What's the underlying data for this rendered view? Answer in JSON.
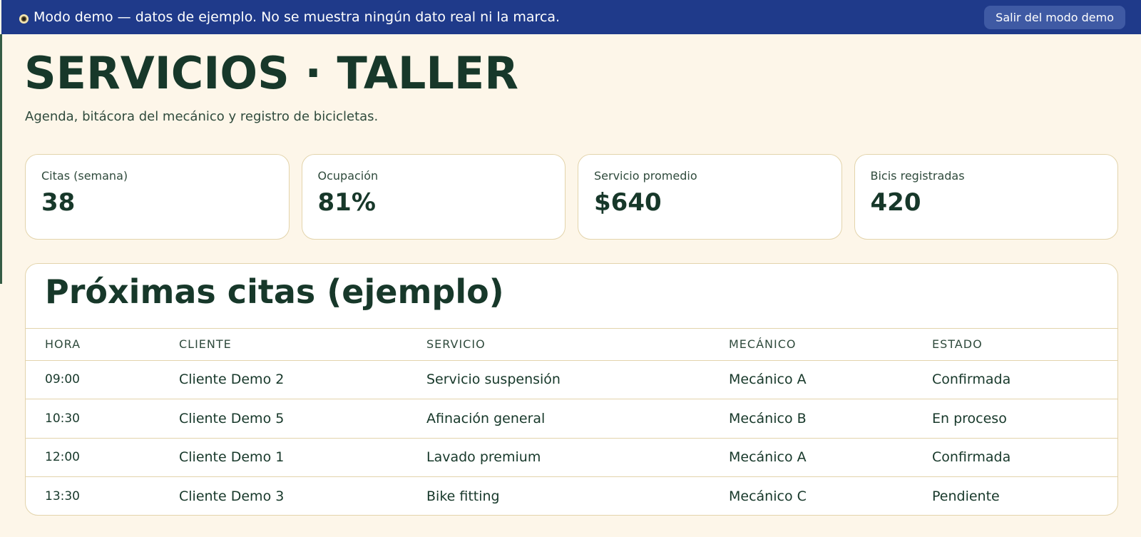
{
  "banner": {
    "message": "Modo demo — datos de ejemplo. No se muestra ningún dato real ni la marca.",
    "icon": "eye-icon",
    "exit_label": "Salir del modo demo"
  },
  "header": {
    "title": "SERVICIOS · TALLER",
    "subtitle": "Agenda, bitácora del mecánico y registro de bicicletas."
  },
  "stats": [
    {
      "label": "Citas (semana)",
      "value": "38"
    },
    {
      "label": "Ocupación",
      "value": "81%"
    },
    {
      "label": "Servicio promedio",
      "value": "$640"
    },
    {
      "label": "Bicis registradas",
      "value": "420"
    }
  ],
  "appointments": {
    "title": "Próximas citas (ejemplo)",
    "columns": [
      "HORA",
      "CLIENTE",
      "SERVICIO",
      "MECÁNICO",
      "ESTADO"
    ],
    "rows": [
      [
        "09:00",
        "Cliente Demo 2",
        "Servicio suspensión",
        "Mecánico A",
        "Confirmada"
      ],
      [
        "10:30",
        "Cliente Demo 5",
        "Afinación general",
        "Mecánico B",
        "En proceso"
      ],
      [
        "12:00",
        "Cliente Demo 1",
        "Lavado premium",
        "Mecánico A",
        "Confirmada"
      ],
      [
        "13:30",
        "Cliente Demo 3",
        "Bike fitting",
        "Mecánico C",
        "Pendiente"
      ]
    ]
  },
  "colors": {
    "banner_bg": "#1f3a8a",
    "page_bg": "#fdf6e9",
    "text_dark_green": "#17382a",
    "card_border": "#e3d4ac"
  }
}
